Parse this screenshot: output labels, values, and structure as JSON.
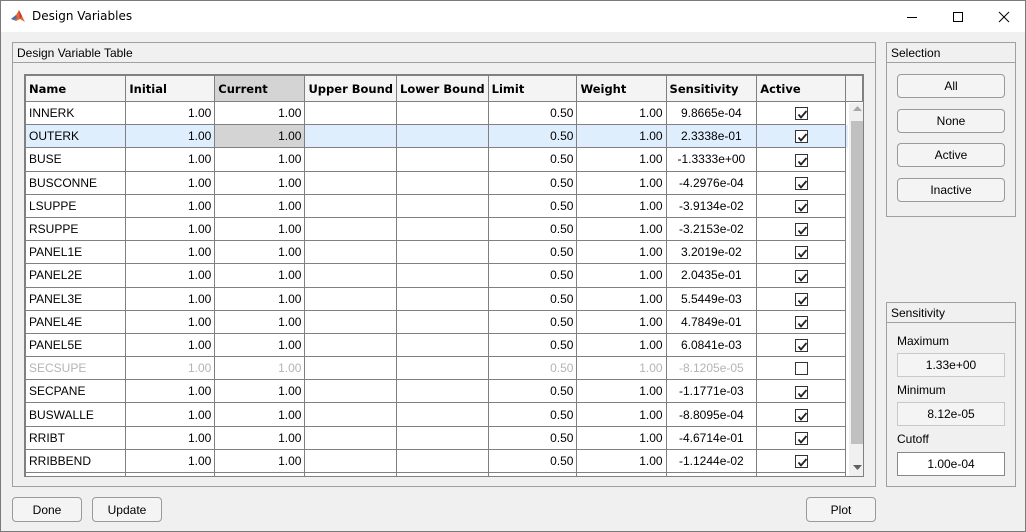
{
  "window": {
    "title": "Design Variables",
    "controls": {
      "minimize": "minimize-icon",
      "maximize": "maximize-icon",
      "close": "close-icon"
    }
  },
  "table_panel": {
    "title": "Design Variable Table",
    "columns": [
      "Name",
      "Initial",
      "Current",
      "Upper Bound",
      "Lower Bound",
      "Limit",
      "Weight",
      "Sensitivity",
      "Active"
    ],
    "selected_row": 1,
    "rows": [
      {
        "name": "INNERK",
        "initial": "1.00",
        "current": "1.00",
        "upper": "",
        "lower": "",
        "limit": "0.50",
        "weight": "1.00",
        "sensitivity": "9.8665e-04",
        "active": true
      },
      {
        "name": "OUTERK",
        "initial": "1.00",
        "current": "1.00",
        "upper": "",
        "lower": "",
        "limit": "0.50",
        "weight": "1.00",
        "sensitivity": "2.3338e-01",
        "active": true
      },
      {
        "name": "BUSE",
        "initial": "1.00",
        "current": "1.00",
        "upper": "",
        "lower": "",
        "limit": "0.50",
        "weight": "1.00",
        "sensitivity": "-1.3333e+00",
        "active": true
      },
      {
        "name": "BUSCONNE",
        "initial": "1.00",
        "current": "1.00",
        "upper": "",
        "lower": "",
        "limit": "0.50",
        "weight": "1.00",
        "sensitivity": "-4.2976e-04",
        "active": true
      },
      {
        "name": "LSUPPE",
        "initial": "1.00",
        "current": "1.00",
        "upper": "",
        "lower": "",
        "limit": "0.50",
        "weight": "1.00",
        "sensitivity": "-3.9134e-02",
        "active": true
      },
      {
        "name": "RSUPPE",
        "initial": "1.00",
        "current": "1.00",
        "upper": "",
        "lower": "",
        "limit": "0.50",
        "weight": "1.00",
        "sensitivity": "-3.2153e-02",
        "active": true
      },
      {
        "name": "PANEL1E",
        "initial": "1.00",
        "current": "1.00",
        "upper": "",
        "lower": "",
        "limit": "0.50",
        "weight": "1.00",
        "sensitivity": "3.2019e-02",
        "active": true
      },
      {
        "name": "PANEL2E",
        "initial": "1.00",
        "current": "1.00",
        "upper": "",
        "lower": "",
        "limit": "0.50",
        "weight": "1.00",
        "sensitivity": "2.0435e-01",
        "active": true
      },
      {
        "name": "PANEL3E",
        "initial": "1.00",
        "current": "1.00",
        "upper": "",
        "lower": "",
        "limit": "0.50",
        "weight": "1.00",
        "sensitivity": "5.5449e-03",
        "active": true
      },
      {
        "name": "PANEL4E",
        "initial": "1.00",
        "current": "1.00",
        "upper": "",
        "lower": "",
        "limit": "0.50",
        "weight": "1.00",
        "sensitivity": "4.7849e-01",
        "active": true
      },
      {
        "name": "PANEL5E",
        "initial": "1.00",
        "current": "1.00",
        "upper": "",
        "lower": "",
        "limit": "0.50",
        "weight": "1.00",
        "sensitivity": "6.0841e-03",
        "active": true
      },
      {
        "name": "SECSUPE",
        "initial": "1.00",
        "current": "1.00",
        "upper": "",
        "lower": "",
        "limit": "0.50",
        "weight": "1.00",
        "sensitivity": "-8.1205e-05",
        "active": false
      },
      {
        "name": "SECPANE",
        "initial": "1.00",
        "current": "1.00",
        "upper": "",
        "lower": "",
        "limit": "0.50",
        "weight": "1.00",
        "sensitivity": "-1.1771e-03",
        "active": true
      },
      {
        "name": "BUSWALLE",
        "initial": "1.00",
        "current": "1.00",
        "upper": "",
        "lower": "",
        "limit": "0.50",
        "weight": "1.00",
        "sensitivity": "-8.8095e-04",
        "active": true
      },
      {
        "name": "RRIBT",
        "initial": "1.00",
        "current": "1.00",
        "upper": "",
        "lower": "",
        "limit": "0.50",
        "weight": "1.00",
        "sensitivity": "-4.6714e-01",
        "active": true
      },
      {
        "name": "RRIBBEND",
        "initial": "1.00",
        "current": "1.00",
        "upper": "",
        "lower": "",
        "limit": "0.50",
        "weight": "1.00",
        "sensitivity": "-1.1244e-02",
        "active": true
      }
    ]
  },
  "selection_panel": {
    "title": "Selection",
    "buttons": [
      "All",
      "None",
      "Active",
      "Inactive"
    ]
  },
  "sensitivity_panel": {
    "title": "Sensitivity",
    "maximum_label": "Maximum",
    "maximum_value": "1.33e+00",
    "minimum_label": "Minimum",
    "minimum_value": "8.12e-05",
    "cutoff_label": "Cutoff",
    "cutoff_value": "1.00e-04"
  },
  "footer": {
    "done_label": "Done",
    "update_label": "Update",
    "plot_label": "Plot"
  }
}
